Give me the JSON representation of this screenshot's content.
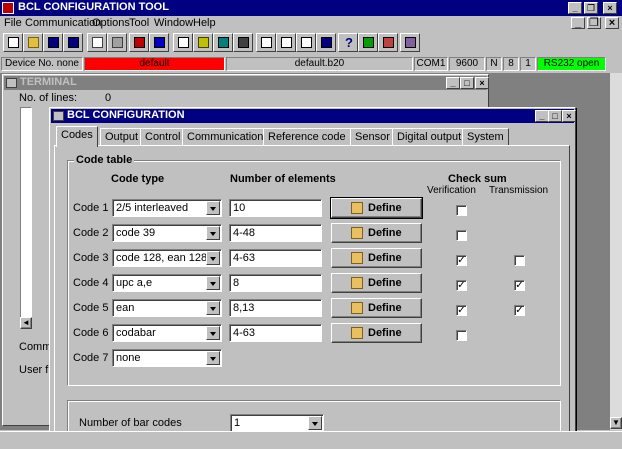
{
  "app": {
    "title": "BCL CONFIGURATION TOOL",
    "menu": [
      "File",
      "Communication",
      "Options",
      "Tool",
      "Window",
      "Help"
    ]
  },
  "status": {
    "device": "Device No. none",
    "config": "default",
    "file": "default.b20",
    "port": "COM1",
    "baud": "9600",
    "parity": "N",
    "databits": "8",
    "stopbits": "1",
    "connection": "RS232 open",
    "colors": {
      "config_bg": "#ff0000",
      "connection_bg": "#00ff00"
    }
  },
  "terminal": {
    "title": "TERMINAL",
    "lines_label": "No. of lines:",
    "lines_value": "0",
    "comm_label": "Comm",
    "user_label": "User f"
  },
  "dialog": {
    "title": "BCL CONFIGURATION",
    "tabs": [
      "Codes",
      "Output",
      "Control",
      "Communication",
      "Reference code",
      "Sensor",
      "Digital output",
      "System"
    ],
    "active_tab": "Codes",
    "code_table": {
      "group_label": "Code table",
      "col_code_type": "Code type",
      "col_elements": "Number of elements",
      "col_checksum": "Check sum",
      "col_verification": "Verification",
      "col_transmission": "Transmission",
      "define_label": "Define",
      "rows": [
        {
          "label": "Code 1",
          "type": "2/5 interleaved",
          "elements": "10",
          "verification": false,
          "transmission": null
        },
        {
          "label": "Code 2",
          "type": "code 39",
          "elements": "4-48",
          "verification": false,
          "transmission": null
        },
        {
          "label": "Code 3",
          "type": "code 128, ean 128",
          "elements": "4-63",
          "verification": true,
          "transmission": false
        },
        {
          "label": "Code 4",
          "type": "upc a,e",
          "elements": "8",
          "verification": true,
          "transmission": true
        },
        {
          "label": "Code 5",
          "type": "ean",
          "elements": "8,13",
          "verification": true,
          "transmission": true
        },
        {
          "label": "Code 6",
          "type": "codabar",
          "elements": "4-63",
          "verification": false,
          "transmission": null
        },
        {
          "label": "Code 7",
          "type": "none",
          "elements": null,
          "verification": null,
          "transmission": null
        }
      ]
    },
    "bar_codes": {
      "label": "Number of bar codes",
      "value": "1"
    }
  }
}
